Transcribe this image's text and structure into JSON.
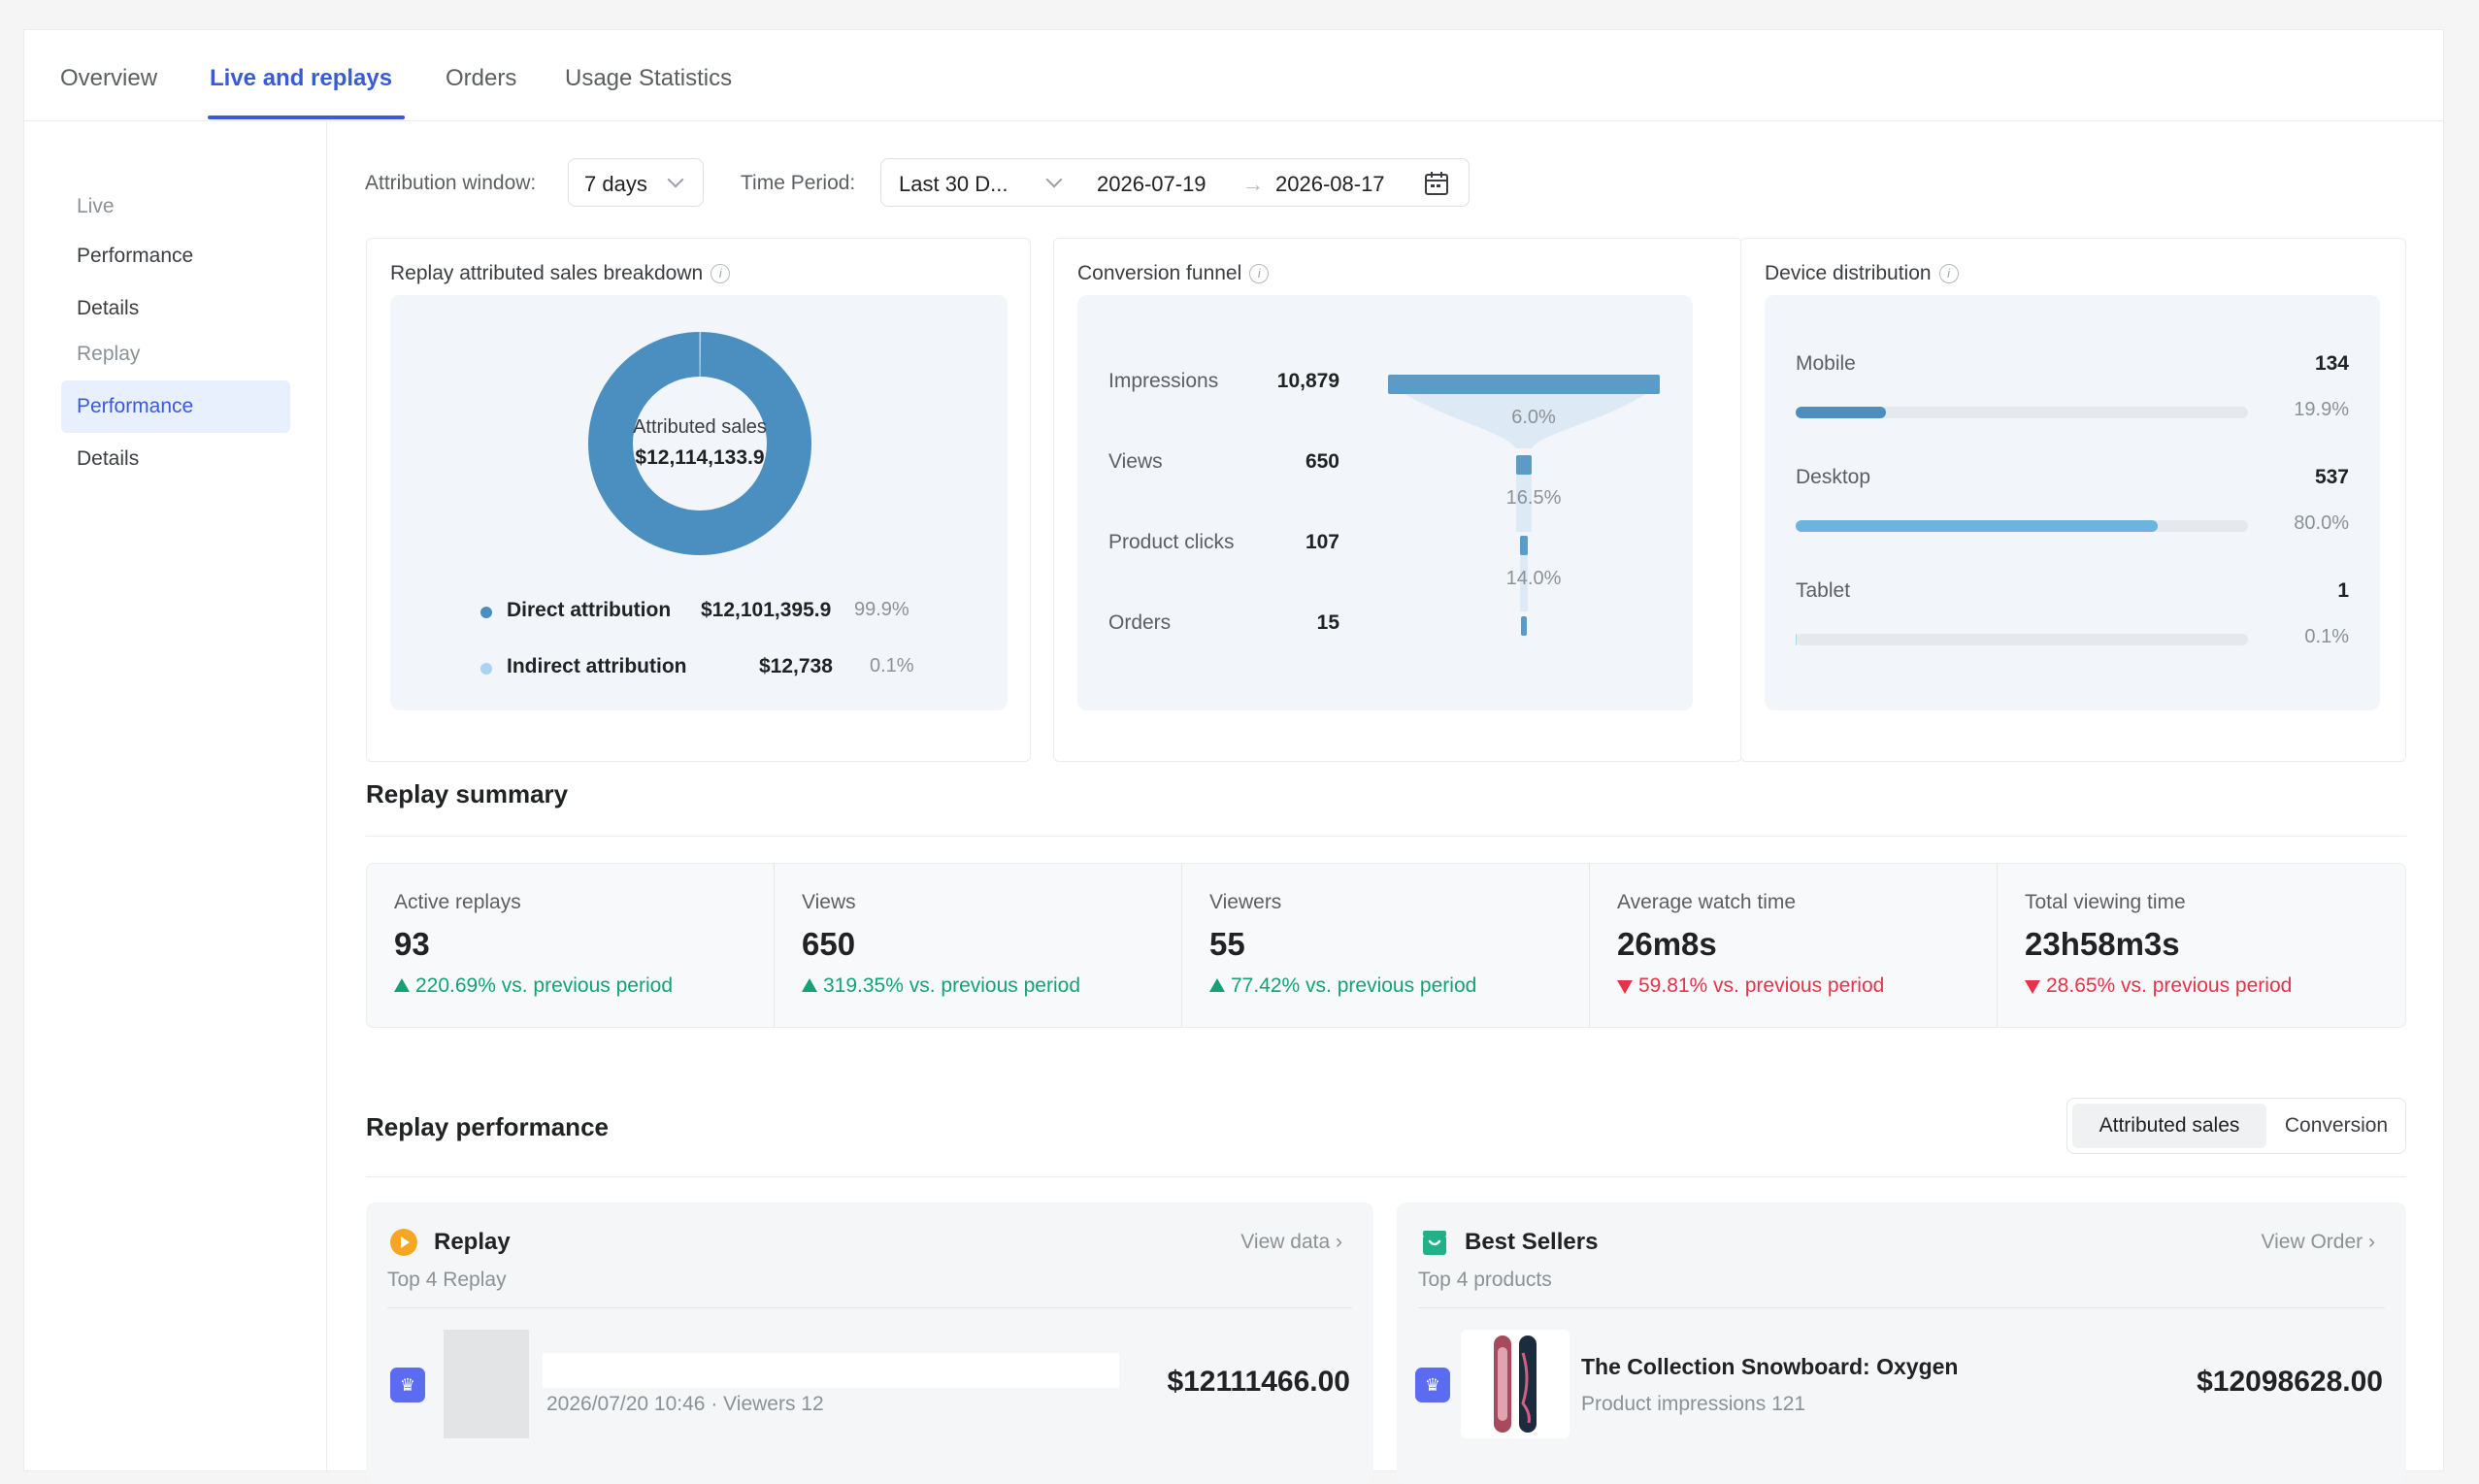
{
  "tabs": [
    {
      "label": "Overview"
    },
    {
      "label": "Live and replays"
    },
    {
      "label": "Orders"
    },
    {
      "label": "Usage Statistics"
    }
  ],
  "sidebar": {
    "live_group": "Live",
    "live_items": [
      "Performance",
      "Details"
    ],
    "replay_group": "Replay",
    "replay_items": [
      "Performance",
      "Details"
    ]
  },
  "filters": {
    "attribution_label": "Attribution window:",
    "attribution_value": "7 days",
    "period_label": "Time Period:",
    "period_value": "Last 30 D...",
    "date_start": "2026-07-19",
    "date_end": "2026-08-17"
  },
  "sales_breakdown": {
    "title": "Replay attributed sales breakdown",
    "center_label": "Attributed sales",
    "center_value": "$12,114,133.9",
    "rows": [
      {
        "name": "Direct attribution",
        "value": "$12,101,395.9",
        "pct": "99.9%",
        "color": "#4b8fc0"
      },
      {
        "name": "Indirect attribution",
        "value": "$12,738",
        "pct": "0.1%",
        "color": "#a9d4f0"
      }
    ]
  },
  "funnel": {
    "title": "Conversion funnel",
    "stages": [
      {
        "label": "Impressions",
        "value": "10,879"
      },
      {
        "label": "Views",
        "value": "650"
      },
      {
        "label": "Product clicks",
        "value": "107"
      },
      {
        "label": "Orders",
        "value": "15"
      }
    ],
    "rates": [
      "6.0%",
      "16.5%",
      "14.0%"
    ]
  },
  "devices": {
    "title": "Device distribution",
    "rows": [
      {
        "label": "Mobile",
        "value": "134",
        "pct": "19.9%",
        "fraction": 0.199,
        "color": "#4b8fc0"
      },
      {
        "label": "Desktop",
        "value": "537",
        "pct": "80.0%",
        "fraction": 0.8,
        "color": "#6cb4de"
      },
      {
        "label": "Tablet",
        "value": "1",
        "pct": "0.1%",
        "fraction": 0.001,
        "color": "#a9d4f0"
      }
    ]
  },
  "summary": {
    "title": "Replay summary",
    "metrics": [
      {
        "label": "Active replays",
        "value": "93",
        "delta": "220.69% vs. previous period",
        "dir": "up"
      },
      {
        "label": "Views",
        "value": "650",
        "delta": "319.35% vs. previous period",
        "dir": "up"
      },
      {
        "label": "Viewers",
        "value": "55",
        "delta": "77.42% vs. previous period",
        "dir": "up"
      },
      {
        "label": "Average watch time",
        "value": "26m8s",
        "delta": "59.81% vs. previous period",
        "dir": "down"
      },
      {
        "label": "Total viewing time",
        "value": "23h58m3s",
        "delta": "28.65% vs. previous period",
        "dir": "down"
      }
    ]
  },
  "performance": {
    "title": "Replay performance",
    "toggle": [
      "Attributed sales",
      "Conversion"
    ],
    "replay_panel": {
      "title": "Replay",
      "link": "View data",
      "subtitle": "Top 4 Replay",
      "row_meta": "2026/07/20 10:46 · Viewers 12",
      "row_amount": "$12111466.00"
    },
    "sellers_panel": {
      "title": "Best Sellers",
      "link": "View Order",
      "subtitle": "Top 4 products",
      "row_name": "The Collection Snowboard: Oxygen",
      "row_meta": "Product impressions 121",
      "row_amount": "$12098628.00"
    }
  }
}
